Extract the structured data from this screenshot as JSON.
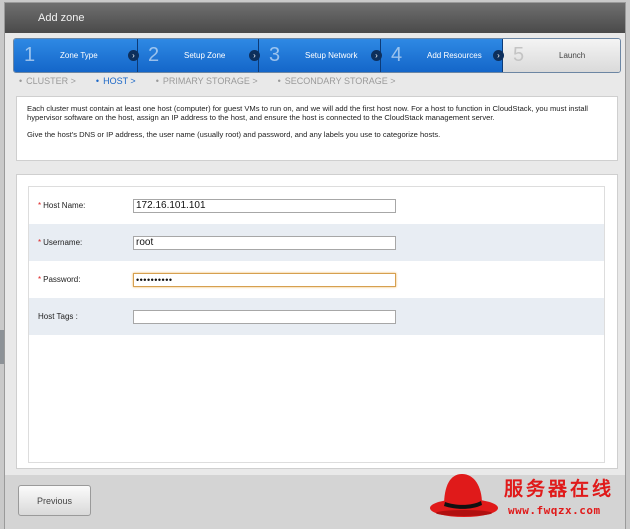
{
  "dialog": {
    "title": "Add zone"
  },
  "steps": [
    {
      "number": "1",
      "label": "Zone Type",
      "state": "done"
    },
    {
      "number": "2",
      "label": "Setup Zone",
      "state": "done"
    },
    {
      "number": "3",
      "label": "Setup Network",
      "state": "done"
    },
    {
      "number": "4",
      "label": "Add Resources",
      "state": "current"
    },
    {
      "number": "5",
      "label": "Launch",
      "state": "pending"
    }
  ],
  "breadcrumb": [
    {
      "label": "CLUSTER >",
      "active": false
    },
    {
      "label": "HOST >",
      "active": true
    },
    {
      "label": "PRIMARY STORAGE >",
      "active": false
    },
    {
      "label": "SECONDARY STORAGE >",
      "active": false
    }
  ],
  "info": {
    "paragraph1": "Each cluster must contain at least one host (computer) for guest VMs to run on, and we will add the first host now. For a host to function in CloudStack, you must install hypervisor software on the host, assign an IP address to the host, and ensure the host is connected to the CloudStack management server.",
    "paragraph2": "Give the host's DNS or IP address, the user name (usually root) and password, and any labels you use to categorize hosts."
  },
  "form": {
    "host_name": {
      "label": "Host Name:",
      "required": true,
      "value": "172.16.101.101"
    },
    "username": {
      "label": "Username:",
      "required": true,
      "value": "root"
    },
    "password": {
      "label": "Password:",
      "required": true,
      "value": "••••••••••"
    },
    "host_tags": {
      "label": "Host Tags :",
      "required": false,
      "value": ""
    }
  },
  "required_marker": "*",
  "footer": {
    "previous_label": "Previous"
  },
  "watermark": {
    "title": "服务器在线",
    "url": "www.fwqzx.com"
  },
  "colors": {
    "accent": "#1b67c7",
    "required": "#dd2222",
    "watermark": "#e01a1a"
  }
}
